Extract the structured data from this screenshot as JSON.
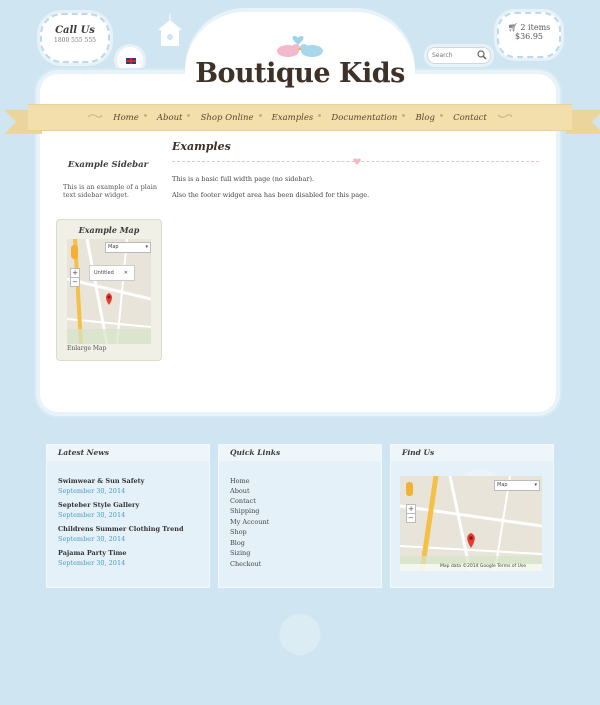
{
  "header": {
    "call_title": "Call Us",
    "call_phone": "1800 555 555",
    "logo": "Boutique Kids",
    "search_placeholder": "Search",
    "cart_items": "2 items",
    "cart_total": "$36.95"
  },
  "nav": {
    "items": [
      "Home",
      "About",
      "Shop Online",
      "Examples",
      "Documentation",
      "Blog",
      "Contact"
    ]
  },
  "sidebar": {
    "title": "Example Sidebar",
    "text": "This is an example of a plain text sidebar widget.",
    "map_title": "Example Map",
    "map_type": "Map",
    "map_popup": "Untitled",
    "map_link": "Enlarge Map"
  },
  "main": {
    "title": "Examples",
    "paragraphs": [
      "This is a basic full width page (no sidebar).",
      "Also the footer widget area has been disabled for this page."
    ]
  },
  "footer": {
    "latest_news_title": "Latest News",
    "news": [
      {
        "title": "Swimwear & Sun Safety",
        "date": "September 30, 2014"
      },
      {
        "title": "Septeber Style Gallery",
        "date": "September 30, 2014"
      },
      {
        "title": "Childrens Summer Clothing Trend",
        "date": "September 30, 2014"
      },
      {
        "title": "Pajama Party Time",
        "date": "September 30, 2014"
      }
    ],
    "quick_links_title": "Quick Links",
    "quick_links": [
      "Home",
      "About",
      "Contact",
      "Shipping",
      "My Account",
      "Shop",
      "Blog",
      "Sizing",
      "Checkout"
    ],
    "find_us_title": "Find Us",
    "map_type": "Map",
    "map_footer_text": "Map data ©2014 Google  Terms of Use"
  },
  "colors": {
    "background": "#cfe6f2",
    "ribbon": "#f3dfac",
    "date_link": "#4a9cc4",
    "logo_text": "#3d3128"
  }
}
